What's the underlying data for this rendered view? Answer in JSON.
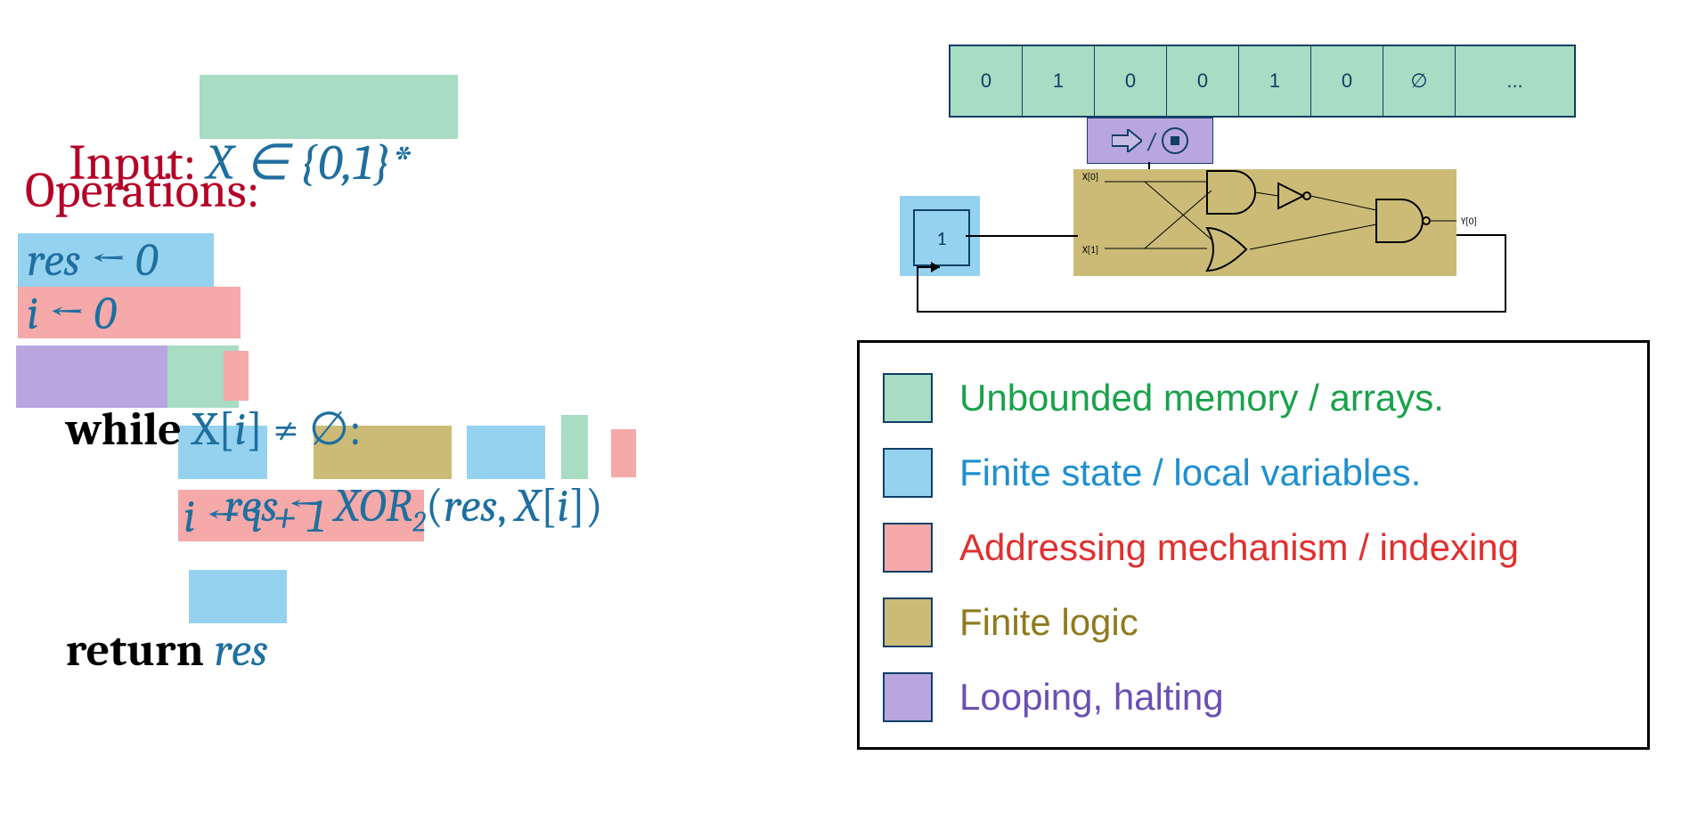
{
  "code": {
    "input_label": "Input:",
    "input_expr": "X ∈ {0,1}*",
    "ops_label": "Operations:",
    "line1": "res ← 0",
    "line2": "i ← 0",
    "while_kw": "while",
    "while_cond_pre": " X[",
    "while_cond_i": "i",
    "while_cond_post": "] ≠ ∅:",
    "assign_res": "res",
    "assign_arrow": " ← ",
    "xor": "XOR",
    "xor_sub": "2",
    "args_open": "(",
    "arg_res": "res",
    "args_comma": ", ",
    "arg_X": "X",
    "arg_br_open": "[",
    "arg_i": "i",
    "arg_br_close": "]",
    "args_close": ")",
    "line_inc": "i ← i + 1",
    "return_kw": "return",
    "return_val": "res"
  },
  "tape": {
    "cells": [
      "0",
      "1",
      "0",
      "0",
      "1",
      "0",
      "∅",
      "..."
    ]
  },
  "head": {
    "slash": "/"
  },
  "state": {
    "value": "1"
  },
  "circuit": {
    "in0": "X[0]",
    "in1": "X[1]",
    "out": "Y[0]"
  },
  "legend": {
    "items": [
      {
        "color": "green",
        "label": "Unbounded memory  / arrays."
      },
      {
        "color": "blue",
        "label": "Finite state / local variables."
      },
      {
        "color": "red",
        "label": "Addressing mechanism / indexing"
      },
      {
        "color": "yellow",
        "label": "Finite logic"
      },
      {
        "color": "purple",
        "label": "Looping, halting"
      }
    ]
  }
}
